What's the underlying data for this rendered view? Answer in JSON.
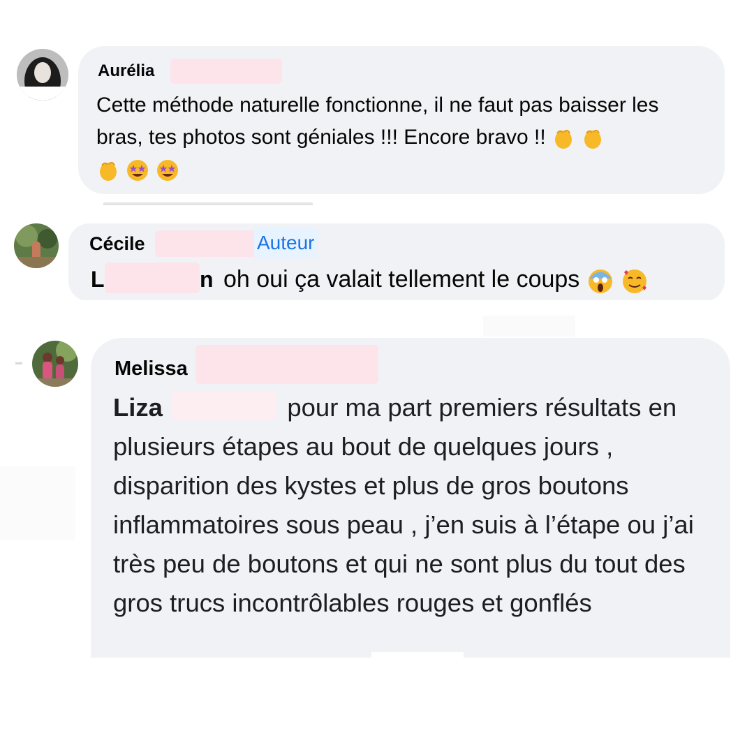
{
  "comments": [
    {
      "author": "Aurélia",
      "text": "Cette méthode naturelle fonctionne, il ne faut pas baisser les bras, tes photos sont géniales !!! Encore bravo !!",
      "emojis": [
        "clapping-hands",
        "clapping-hands",
        "clapping-hands",
        "star-struck",
        "star-struck"
      ]
    },
    {
      "author": "Cécile",
      "badge": "Auteur",
      "mention": "L",
      "mention_end": "n",
      "text": "oh oui ça valait tellement le coups",
      "emojis": [
        "face-screaming-in-fear",
        "smiling-face-with-hearts"
      ]
    },
    {
      "author": "Melissa",
      "mention": "Liza",
      "text": "pour ma part premiers résultats en plusieurs étapes au bout de quelques jours , disparition des kystes et plus de gros boutons inflammatoires sous peau , j’en suis à l’étape ou j’ai très peu de boutons et qui ne sont plus du tout des gros trucs incontrôlables rouges et gonflés"
    }
  ],
  "colors": {
    "bubble": "#f0f2f5",
    "author_badge": "#1b74e4",
    "redaction": "#fde4ea"
  }
}
